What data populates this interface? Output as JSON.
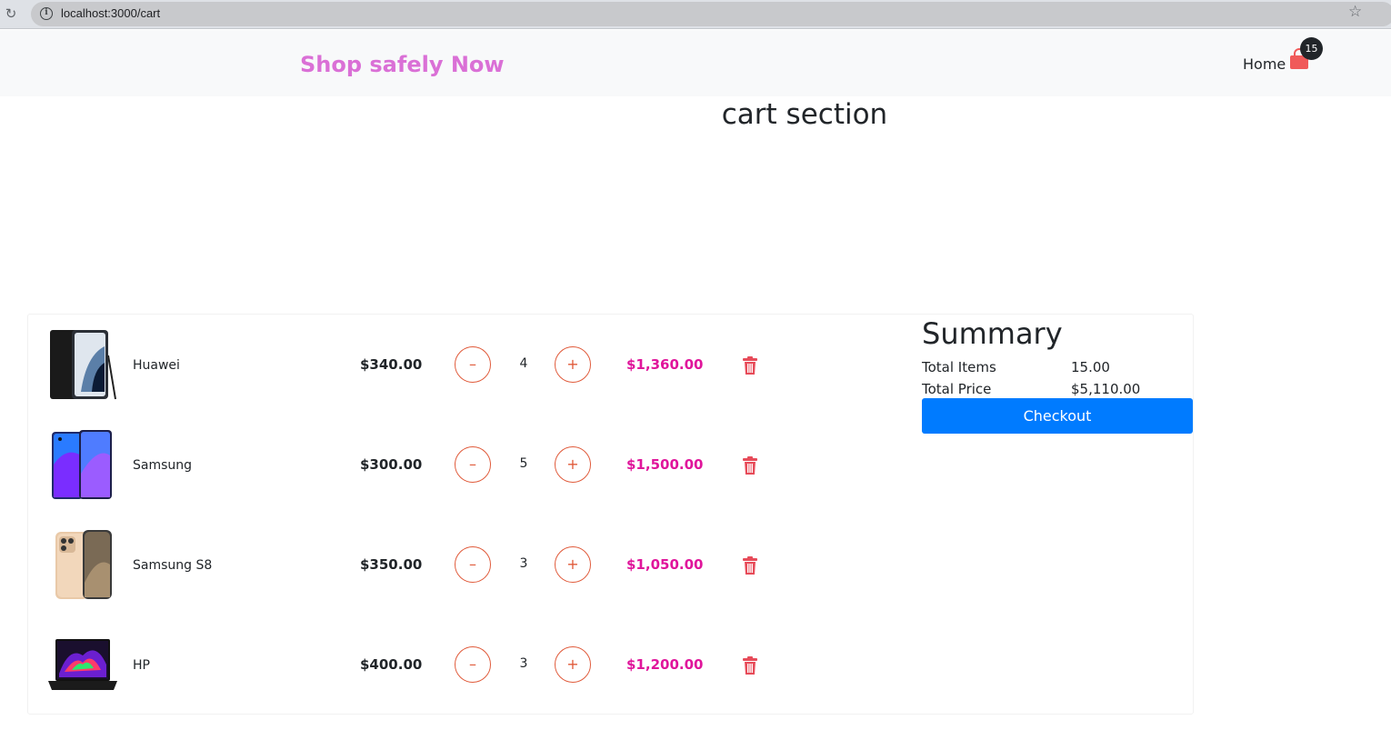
{
  "browser": {
    "url": "localhost:3000/cart"
  },
  "navbar": {
    "brand": "Shop safely Now",
    "home_label": "Home",
    "cart_count": "15"
  },
  "page_title": "cart section",
  "cart": {
    "items": [
      {
        "name": "Huawei",
        "price": "$340.00",
        "quantity": "4",
        "total": "$1,360.00",
        "image": "phone-huawei"
      },
      {
        "name": "Samsung",
        "price": "$300.00",
        "quantity": "5",
        "total": "$1,500.00",
        "image": "phone-samsung"
      },
      {
        "name": "Samsung S8",
        "price": "$350.00",
        "quantity": "3",
        "total": "$1,050.00",
        "image": "phone-gold"
      },
      {
        "name": "HP",
        "price": "$400.00",
        "quantity": "3",
        "total": "$1,200.00",
        "image": "laptop-hp"
      }
    ],
    "minus_symbol": "–",
    "plus_symbol": "+"
  },
  "summary": {
    "title": "Summary",
    "total_items_label": "Total Items",
    "total_items_value": "15.00",
    "total_price_label": "Total Price",
    "total_price_value": "$5,110.00",
    "checkout_label": "Checkout"
  },
  "colors": {
    "brand": "#da70d6",
    "accent_total": "#e0159b",
    "qty_border": "#e05a3a",
    "trash": "#e74c5a",
    "checkout": "#007bff",
    "bag": "#f05a5a"
  }
}
